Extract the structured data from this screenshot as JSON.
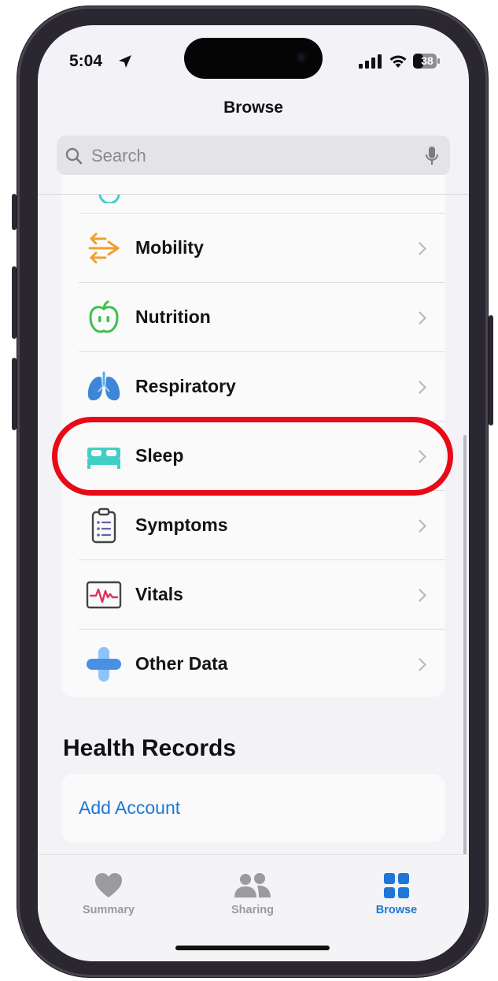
{
  "status_bar": {
    "time": "5:04",
    "battery": "38"
  },
  "nav": {
    "title": "Browse"
  },
  "search": {
    "placeholder": "Search"
  },
  "categories": [
    {
      "label": "Mobility",
      "icon": "mobility-arrows-icon",
      "color": "#f0a12b"
    },
    {
      "label": "Nutrition",
      "icon": "apple-icon",
      "color": "#3fbf4e"
    },
    {
      "label": "Respiratory",
      "icon": "lungs-icon",
      "color": "#3d86d8"
    },
    {
      "label": "Sleep",
      "icon": "bed-icon",
      "color": "#3fcfc4"
    },
    {
      "label": "Symptoms",
      "icon": "clipboard-list-icon",
      "color": "#6464a0"
    },
    {
      "label": "Vitals",
      "icon": "heart-rate-monitor-icon",
      "color": "#e0315a"
    },
    {
      "label": "Other Data",
      "icon": "plus-icon",
      "color": "#4a90e2"
    }
  ],
  "highlighted_item": "Sleep",
  "highlight_color": "#e80a17",
  "health_records": {
    "title": "Health Records",
    "add_account": "Add Account"
  },
  "tabs": [
    {
      "label": "Summary",
      "icon": "heart-icon",
      "active": false
    },
    {
      "label": "Sharing",
      "icon": "people-icon",
      "active": false
    },
    {
      "label": "Browse",
      "icon": "grid-icon",
      "active": true
    }
  ],
  "colors": {
    "accent": "#1e77d6",
    "inactive_tab": "#9a9aa0"
  }
}
